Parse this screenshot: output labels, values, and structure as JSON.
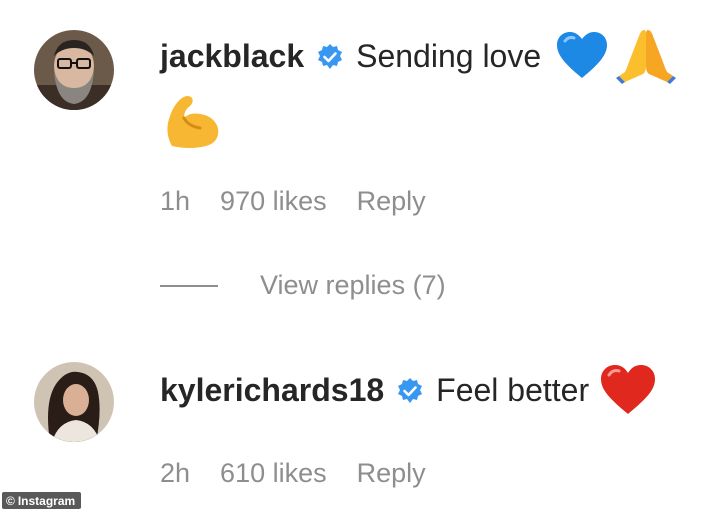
{
  "comments": [
    {
      "username": "jackblack",
      "text": "Sending love",
      "emojis": [
        "blue-heart",
        "folded-hands",
        "flexed-biceps"
      ],
      "time": "1h",
      "likes": "970 likes",
      "reply": "Reply",
      "view_replies": "View replies (7)"
    },
    {
      "username": "kylerichards18",
      "text": "Feel better",
      "emojis": [
        "red-heart"
      ],
      "time": "2h",
      "likes": "610 likes",
      "reply": "Reply"
    }
  ],
  "watermark": "Instagram",
  "watermark_symbol": "©",
  "colors": {
    "text": "#262626",
    "meta": "#8e8e8e",
    "verified": "#3897f0",
    "blue_heart": "#1e88e5",
    "red_heart": "#e0281f"
  }
}
